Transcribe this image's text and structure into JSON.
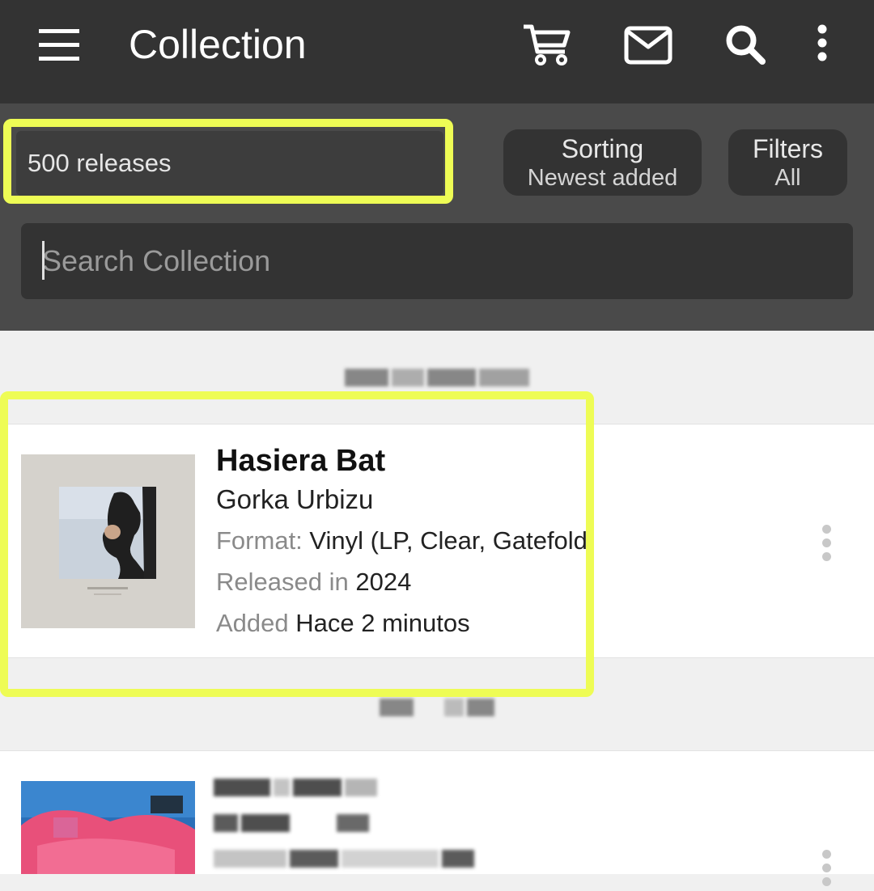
{
  "appbar": {
    "title": "Collection",
    "icons": [
      "menu-icon",
      "cart-icon",
      "mail-icon",
      "search-icon",
      "more-vert-icon"
    ]
  },
  "controls": {
    "releases_count": "500 releases",
    "sorting": {
      "label": "Sorting",
      "value": "Newest added"
    },
    "filters": {
      "label": "Filters",
      "value": "All"
    },
    "search_placeholder": "Search Collection"
  },
  "releases": [
    {
      "title": "Hasiera Bat",
      "artist": "Gorka Urbizu",
      "format_key": "Format:",
      "format_value": "Vinyl (LP, Clear, Gatefold",
      "released_key": "Released in",
      "released_value": "2024",
      "added_key": "Added",
      "added_value": "Hace 2 minutos"
    }
  ],
  "colors": {
    "appbar": "#333333",
    "controls_bg": "#4a4a4a",
    "highlight": "#eefc55",
    "list_bg": "#f0f0f0"
  }
}
